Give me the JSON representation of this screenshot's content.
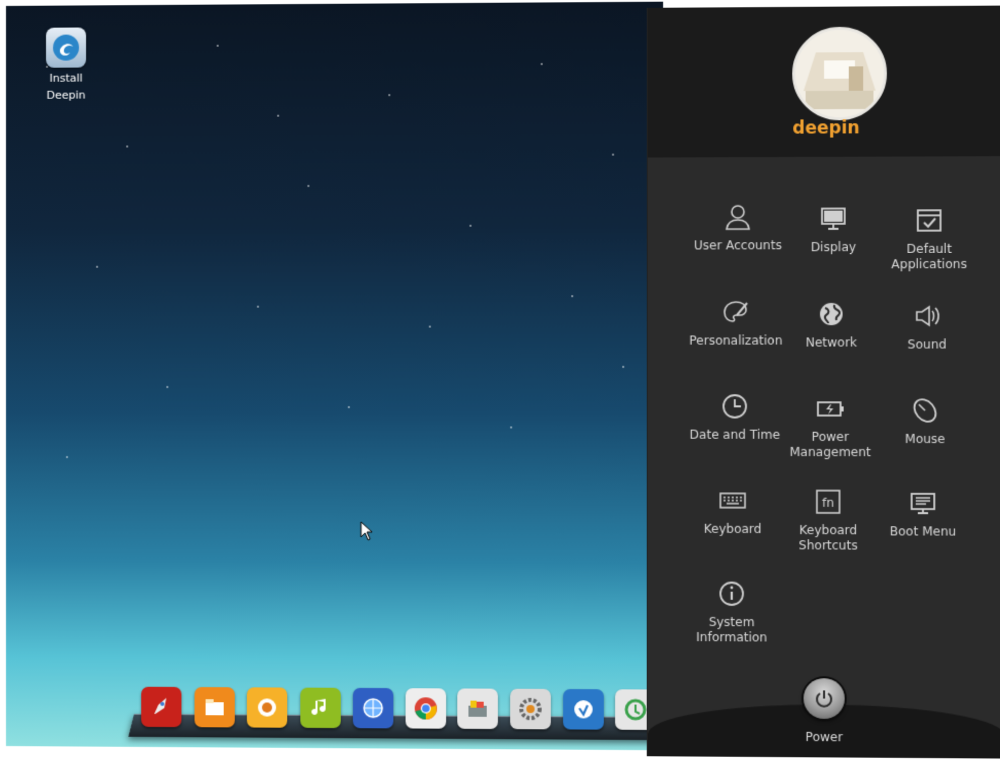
{
  "desktop": {
    "icon": {
      "label_line1": "Install",
      "label_line2": "Deepin",
      "icon": "deepin-installer-icon"
    }
  },
  "dock": {
    "apps": [
      {
        "icon": "launcher-rocket-icon",
        "color": "#c8221b"
      },
      {
        "icon": "file-manager-icon",
        "color": "#f08a1c"
      },
      {
        "icon": "deepin-store-icon",
        "color": "#f6b129"
      },
      {
        "icon": "music-player-icon",
        "color": "#8fbd22"
      },
      {
        "icon": "browser-globe-icon",
        "color": "#2f5fc3"
      },
      {
        "icon": "chrome-icon",
        "color": "#eeeeee"
      },
      {
        "icon": "file-cabinet-icon",
        "color": "#e6e6e6"
      },
      {
        "icon": "settings-gear-icon",
        "color": "#d9d9d9"
      },
      {
        "icon": "web-app-icon",
        "color": "#2a78c8"
      },
      {
        "icon": "update-icon",
        "color": "#e6e6e6"
      }
    ]
  },
  "panel": {
    "username": "deepin",
    "items": [
      {
        "line1": "User Accounts",
        "line2": "",
        "icon": "user-icon"
      },
      {
        "line1": "Display",
        "line2": "",
        "icon": "monitor-icon"
      },
      {
        "line1": "Default",
        "line2": "Applications",
        "icon": "default-apps-icon"
      },
      {
        "line1": "Personalization",
        "line2": "",
        "icon": "palette-icon"
      },
      {
        "line1": "Network",
        "line2": "",
        "icon": "globe-icon"
      },
      {
        "line1": "Sound",
        "line2": "",
        "icon": "speaker-icon"
      },
      {
        "line1": "Date and Time",
        "line2": "",
        "icon": "clock-icon"
      },
      {
        "line1": "Power",
        "line2": "Management",
        "icon": "battery-icon"
      },
      {
        "line1": "Mouse",
        "line2": "",
        "icon": "mouse-icon"
      },
      {
        "line1": "Keyboard",
        "line2": "",
        "icon": "keyboard-icon"
      },
      {
        "line1": "Keyboard",
        "line2": "Shortcuts",
        "icon": "fn-key-icon"
      },
      {
        "line1": "Boot Menu",
        "line2": "",
        "icon": "boot-menu-icon"
      },
      {
        "line1": "System",
        "line2": "Information",
        "icon": "info-icon"
      }
    ],
    "power_label": "Power",
    "accent_color": "#f0a030"
  }
}
